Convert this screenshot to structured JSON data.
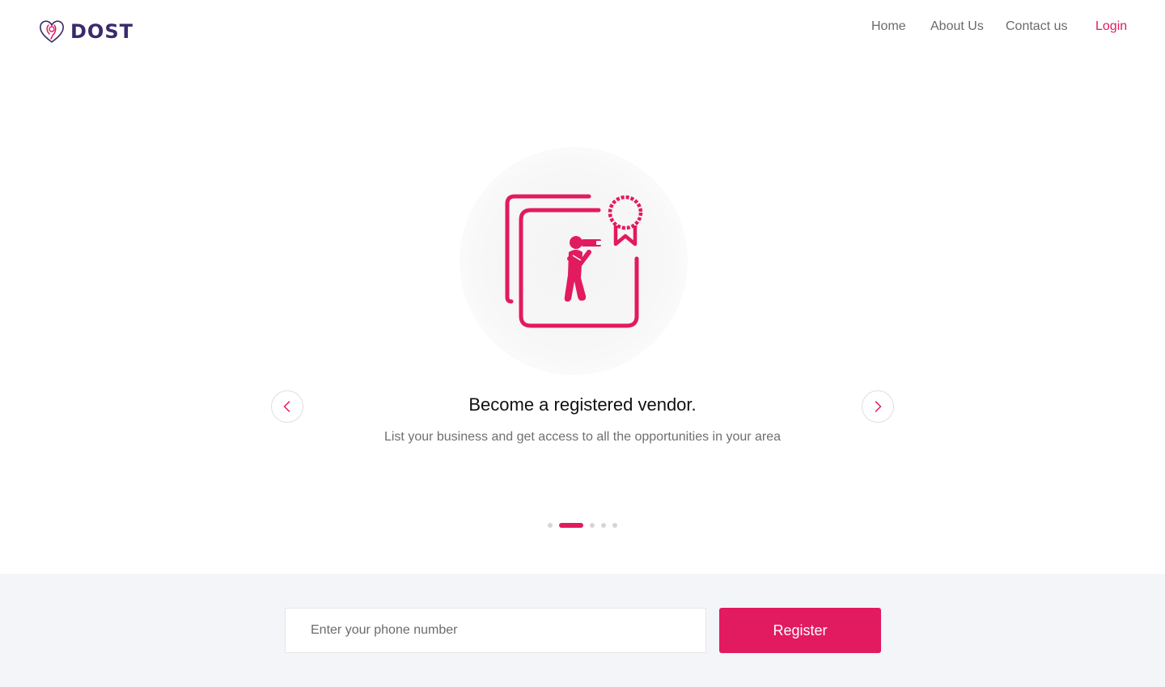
{
  "brand": {
    "name": "DOST",
    "logo_icon": "heart-pin-icon",
    "accent_color": "#e21a5f",
    "logo_color": "#3a2a6b"
  },
  "nav": {
    "items": [
      {
        "label": "Home"
      },
      {
        "label": "About Us"
      },
      {
        "label": "Contact us"
      }
    ],
    "login_label": "Login"
  },
  "carousel": {
    "illustration_icon": "photographer-certificate-icon",
    "title": "Become a registered vendor.",
    "subtitle": "List your business and get access to all the opportunities in your area",
    "prev_icon": "chevron-left-icon",
    "next_icon": "chevron-right-icon",
    "slide_count": 5,
    "active_index": 1
  },
  "register": {
    "phone_placeholder": "Enter your phone number",
    "phone_value": "",
    "button_label": "Register"
  }
}
